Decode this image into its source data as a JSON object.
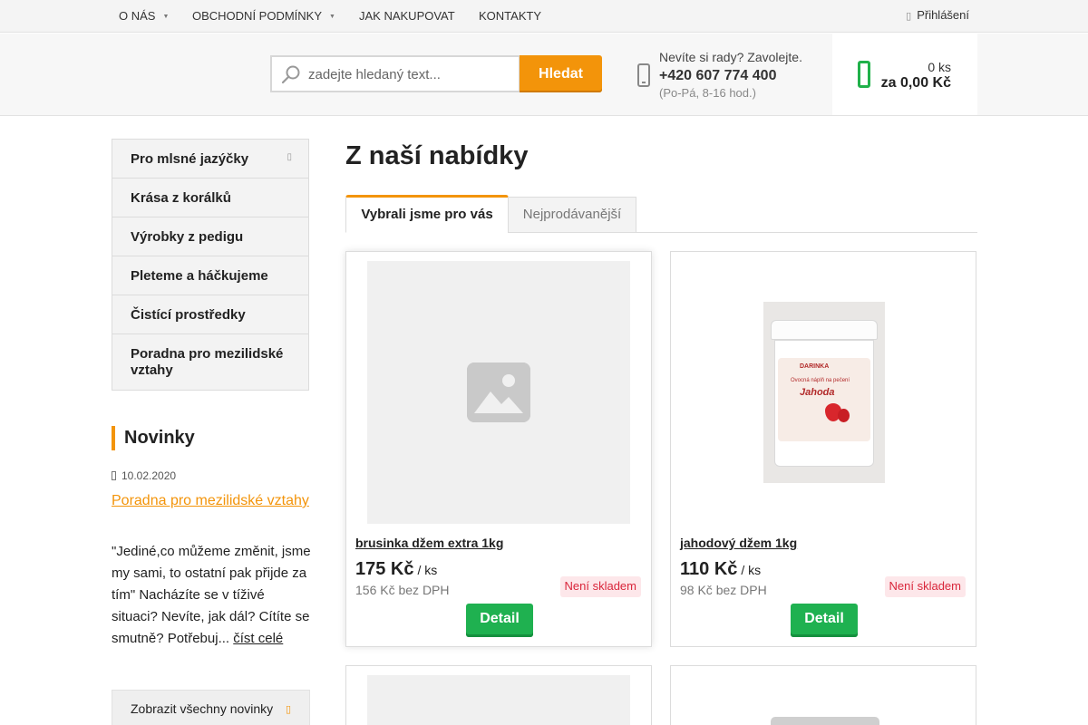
{
  "topnav": {
    "items": [
      {
        "label": "O nás",
        "has_submenu": true
      },
      {
        "label": "Obchodní podmínky",
        "has_submenu": true
      },
      {
        "label": "Jak nakupovat",
        "has_submenu": false
      },
      {
        "label": "Kontakty",
        "has_submenu": false
      }
    ],
    "login_label": "Přihlášení",
    "submenu_glyph": "▼",
    "login_icon": "user-icon"
  },
  "search": {
    "placeholder": "zadejte hledaný text...",
    "button_label": "Hledat",
    "icon": "search-icon"
  },
  "contact": {
    "question": "Nevíte si rady? Zavolejte.",
    "phone": "+420 607 774 400",
    "hours": "(Po-Pá, 8-16 hod.)",
    "icon": "phone-icon"
  },
  "cart": {
    "count": "0 ks",
    "total": "za 0,00 Kč",
    "icon": "cart-icon"
  },
  "categories": [
    {
      "label": "Pro mlsné jazýčky",
      "has_submenu": true
    },
    {
      "label": "Krása z korálků",
      "has_submenu": false
    },
    {
      "label": "Výrobky z pedigu",
      "has_submenu": false
    },
    {
      "label": "Pleteme a háčkujeme",
      "has_submenu": false
    },
    {
      "label": "Čistící prostředky",
      "has_submenu": false
    },
    {
      "label": "Poradna pro mezilidské vztahy",
      "has_submenu": false
    }
  ],
  "news": {
    "heading": "Novinky",
    "date": "10.02.2020",
    "title": "Poradna pro mezilidské vztahy",
    "text": "\"Jediné,co můžeme změnit, jsme my sami, to ostatní pak přijde za tím\" Nacházíte se v tíživé situaci? Nevíte, jak dál? Cítíte se smutně? Potřebuj...",
    "more_label": "číst celé",
    "all_label": "Zobrazit všechny novinky"
  },
  "main": {
    "title": "Z naší nabídky",
    "tabs": [
      {
        "label": "Vybrali jsme pro vás",
        "active": true
      },
      {
        "label": "Nejprodávanější",
        "active": false
      }
    ]
  },
  "products": [
    {
      "name": "brusinka džem extra 1kg",
      "price": "175 Kč",
      "unit": "/ ks",
      "net_price": "156 Kč bez DPH",
      "stock": "Není skladem",
      "detail_label": "Detail",
      "image": "placeholder-image-icon"
    },
    {
      "name": "jahodový džem 1kg",
      "price": "110 Kč",
      "unit": "/ ks",
      "net_price": "98 Kč bez DPH",
      "stock": "Není skladem",
      "detail_label": "Detail",
      "image": "jam-bucket-photo",
      "image_text": {
        "brand": "DARINKA",
        "subtitle": "Ovocná náplň na pečení",
        "flavor": "Jahoda"
      }
    }
  ],
  "colors": {
    "accent": "#f3940a",
    "green": "#1fb150",
    "out_of_stock": "#d9263b"
  }
}
